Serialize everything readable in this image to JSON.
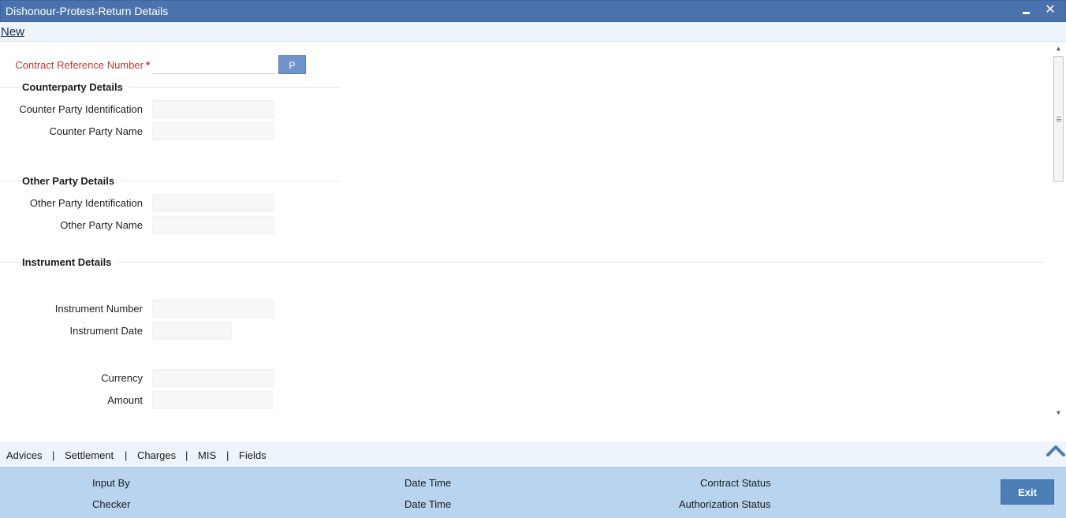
{
  "window": {
    "title": "Dishonour-Protest-Return Details",
    "minimize_icon": "minimize-icon",
    "close_icon": "close-icon",
    "close_glyph": "✕"
  },
  "toolbar": {
    "new_label": "New"
  },
  "contract": {
    "label": "Contract Reference Number",
    "required_mark": "*",
    "value": "",
    "p_button": "P"
  },
  "counterparty": {
    "title": "Counterparty Details",
    "identification_label": "Counter Party Identification",
    "identification_value": "",
    "name_label": "Counter Party Name",
    "name_value": ""
  },
  "other_party": {
    "title": "Other Party Details",
    "identification_label": "Other Party Identification",
    "identification_value": "",
    "name_label": "Other Party Name",
    "name_value": ""
  },
  "instrument": {
    "title": "Instrument Details",
    "number_label": "Instrument Number",
    "number_value": "",
    "date_label": "Instrument Date",
    "date_value": "",
    "currency_label": "Currency",
    "currency_value": "",
    "amount_label": "Amount",
    "amount_value": ""
  },
  "tabs": {
    "items": [
      "Advices",
      "Settlement",
      "Charges",
      "MIS",
      "Fields"
    ],
    "separator": "|"
  },
  "footer": {
    "input_by": "Input By",
    "checker": "Checker",
    "date_time_1": "Date Time",
    "date_time_2": "Date Time",
    "contract_status": "Contract Status",
    "authorization_status": "Authorization Status",
    "exit_label": "Exit"
  },
  "colors": {
    "titlebar": "#4a73ad",
    "required": "#c0392b",
    "footer": "#b9d4ee",
    "exit_button": "#4a7fb5",
    "p_button": "#6f94cc"
  }
}
